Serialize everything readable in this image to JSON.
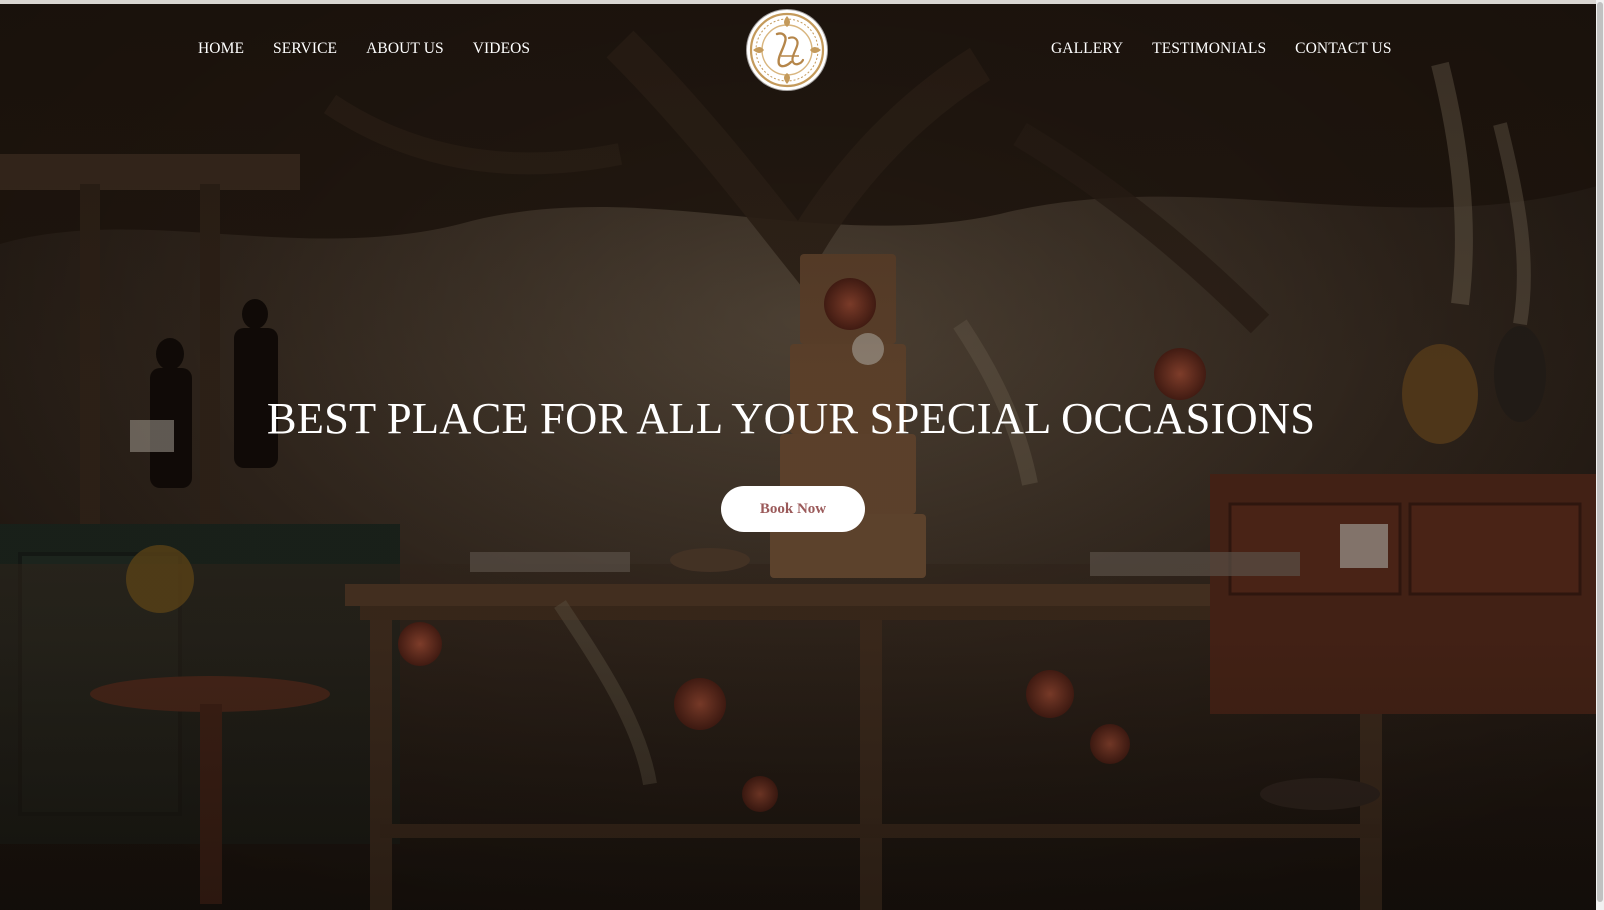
{
  "nav": {
    "left_items": [
      {
        "label": "HOME"
      },
      {
        "label": "SERVICE"
      },
      {
        "label": "ABOUT US"
      },
      {
        "label": "VIDEOS"
      }
    ],
    "right_items": [
      {
        "label": "GALLERY"
      },
      {
        "label": "TESTIMONIALS"
      },
      {
        "label": "CONTACT US"
      }
    ]
  },
  "logo": {
    "icon": "monogram-logo-icon"
  },
  "hero": {
    "headline": "BEST PLACE FOR ALL YOUR SPECIAL OCCASIONS",
    "cta_label": "Book Now",
    "background": "event-dessert-table-photo"
  },
  "colors": {
    "overlay": "#1a120c",
    "nav_text": "#ffffff",
    "cta_background": "#ffffff",
    "cta_text": "#9b5a5a",
    "logo_gold": "#c49a5b"
  }
}
